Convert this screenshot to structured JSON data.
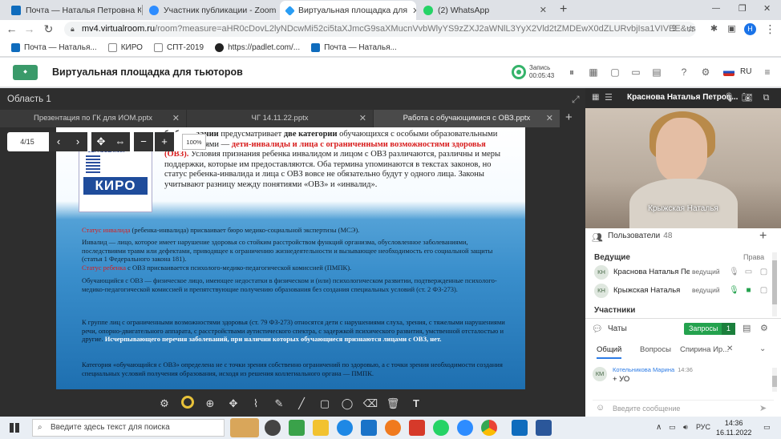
{
  "browser": {
    "tabs": [
      {
        "title": "Почта — Наталья Петровна Кр",
        "color": "#0f6cbd"
      },
      {
        "title": "Участник публикации - Zoom",
        "color": "#2d8cff"
      },
      {
        "title": "Виртуальная площадка для",
        "color": "#2a9df4"
      },
      {
        "title": "(2) WhatsApp",
        "color": "#25d366"
      }
    ],
    "url_host": "mv4.virtualroom.ru",
    "url_path": "/room?measure=aHR0cDovL2lyNDcwMi52ci5taXJmcG9saXMucnVvbWlyYS9zZXJ2aWNlL3YyX2Vld2tZMDEwX0dZLURvbjIsa1VIVEE&user=N...",
    "bookmarks": [
      "Почта — Наталья...",
      "КИРО",
      "СПТ-2019",
      "https://padlet.com/...",
      "Почта — Наталья..."
    ]
  },
  "app": {
    "title": "Виртуальная площадка для тьюторов",
    "rec_label": "Запись",
    "rec_time": "00:05:43",
    "lang": "RU"
  },
  "workspace": {
    "area_title": "Область 1",
    "file_tabs": [
      "Презентация по ГК для ИОМ.pptx",
      "ЧГ 14.11.22.pptx",
      "Работа с обучающимися с ОВЗ.pptx"
    ],
    "page_counter": "4/15",
    "zoom": "100%"
  },
  "slide": {
    "logo_top": "КУРСКИЙ ИНСТИТУТ РАЗВИТИЯ ОБРАЗОВАНИЯ",
    "logo_text": "КИРО",
    "p1_a": "б образовании",
    "p1_b": " предусматривает ",
    "p1_c": "две категории",
    "p1_d": " обучающихся с особыми образовательными потребностями — ",
    "p1_e": "дети-инвалиды и лица с ограниченными возможностями здоровья (ОВЗ).",
    "p1_f": " Условия признания ребенка инвалидом и лицом с ОВЗ различаются, различны и меры поддержки, которые им предоставляются. Оба термина упоминаются в текстах законов, но статус ребенка-инвалида и лица с ОВЗ вовсе не обязательно будут у одного лица. Законы учитывают разницу между понятиями «ОВЗ» и «инвалид».",
    "p2_a": "Статус инвалида",
    "p2_b": " (ребенка-инвалида) присваивает бюро медико-социальной экспертизы (МСЭ).",
    "p3": "Инвалид — лицо, которое имеет нарушение здоровья со стойким расстройством функций организма, обусловленное заболеваниями, последствиями травм или дефектами, приводящее к ограничению жизнедеятельности и вызывающее необходимость его социальной защиты (статья 1 Федерального закона 181).",
    "p4_a": "Статус ребенка",
    "p4_b": " с ОВЗ присваивается психолого-медико-педагогической комиссией (ПМПК).",
    "p5": "Обучающийся с ОВЗ — физическое лицо, имеющее недостатки в физическом и (или) психологическом развитии, подтвержденные психолого-медико-педагогической комиссией и препятствующие получению образования без создания специальных условий (ст. 2 ФЗ-273).",
    "p6_a": "К группе лиц с ограниченными возможностями здоровья (ст. 79 ФЗ-273) относятся дети с нарушениями слуха, зрения, с тяжелыми нарушениями речи, опорно-двигательного аппарата, с расстройствами аутистического спектра, с задержкой психического развития, умственной отсталостью и другие. ",
    "p6_b": "Исчерпывающего перечня заболеваний, при наличии которых обучающиеся признаются лицами с ОВЗ, нет.",
    "p7": "Категория «обучающийся с ОВЗ» определена не с точки зрения собственно ограничений по здоровью, а с точки зрения необходимости создания специальных условий получения образования, исходя из решения коллегиального органа — ПМПК."
  },
  "video": {
    "header_name": "Краснова Наталья Петров...",
    "overlay_name": "Крыжская Наталья"
  },
  "users": {
    "label": "Пользователи",
    "count": "48",
    "section_leaders": "Ведущие",
    "rights": "Права",
    "section_participants": "Участники",
    "rows": [
      {
        "initials": "КН",
        "name": "Краснова Наталья Пе...",
        "role": "ведущий"
      },
      {
        "initials": "КН",
        "name": "Крыжская Наталья",
        "role": "ведущий"
      }
    ]
  },
  "chats": {
    "label": "Чаты",
    "requests_label": "Запросы",
    "requests_count": "1",
    "tabs": [
      "Общий",
      "Вопросы",
      "Спирина Ир..."
    ],
    "message": {
      "initials": "КМ",
      "author": "Котельникова Марина",
      "time": "14:36",
      "text": "+ УО"
    },
    "input_placeholder": "Введите сообщение"
  },
  "taskbar": {
    "search_placeholder": "Введите здесь текст для поиска",
    "lang": "РУС",
    "time": "14:36",
    "date": "16.11.2022"
  }
}
